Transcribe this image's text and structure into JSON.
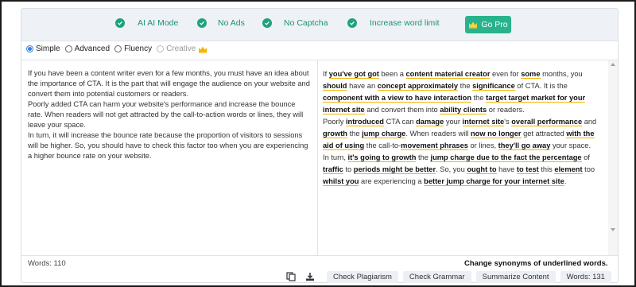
{
  "features": [
    {
      "label": "AI AI Mode",
      "icon": "check-circle-icon"
    },
    {
      "label": "No Ads",
      "icon": "check-circle-icon"
    },
    {
      "label": "No Captcha",
      "icon": "check-circle-icon"
    },
    {
      "label": "Increase word limit",
      "icon": "check-circle-icon"
    }
  ],
  "go_pro": {
    "label": "Go Pro",
    "icon": "crown-icon"
  },
  "modes": [
    {
      "label": "Simple",
      "selected": true
    },
    {
      "label": "Advanced",
      "selected": false
    },
    {
      "label": "Fluency",
      "selected": false
    },
    {
      "label": "Creative",
      "selected": false,
      "disabled": true,
      "icon": "crown-icon"
    }
  ],
  "input_text": {
    "p1": "If you have been a content writer even for a few months, you must have an idea about the importance of CTA. It is the part that will engage the audience on your website and convert them into potential customers or readers.",
    "p2": "Poorly added CTA can harm your website's performance and increase the bounce rate. When readers will not get attracted by the call-to-action words or lines, they will leave your space.",
    "p3": "In turn, it will increase the bounce rate because the proportion of visitors to sessions will be higher. So, you should have to check this factor too when you are experiencing a higher bounce rate on your website."
  },
  "output_text": {
    "s1": "If ",
    "s1b": "you've got got",
    "s2": " been a ",
    "s2b": "content material creator",
    "s3": " even for ",
    "s3b": "some",
    "s4": " months, you ",
    "s4b": "should",
    "s5": " have an ",
    "s5b": "concept approximately",
    "s6": " the ",
    "s6b": "significance",
    "s7": " of CTA. It is the ",
    "s7b": "component with a view to have interaction",
    "s8": " the ",
    "s8b": "target target market for your internet site",
    "s9": " and convert them into ",
    "s9b": "ability clients",
    "s10": " or readers.",
    "s11": "Poorly ",
    "s11b": "introduced",
    "s12": " CTA can ",
    "s12b": "damage",
    "s13": " your ",
    "s13b": "internet site",
    "s14": "'s ",
    "s14b": "overall performance",
    "s15": " and ",
    "s15b": "growth",
    "s16": " the ",
    "s16b": "jump charge",
    "s17": ". When readers will ",
    "s17b": "now no longer",
    "s18": " get attracted ",
    "s18b": "with the aid of using",
    "s19": " the call-to-",
    "s19b": "movement phrases",
    "s20": " or lines, ",
    "s20b": "they'll go away",
    "s21": " your space.",
    "s22": "In turn, ",
    "s22b": "it's going to growth",
    "s23": " the ",
    "s23b": "jump charge due to the fact the percentage",
    "s24": " of ",
    "s24b": "traffic",
    "s25": " to ",
    "s25b": "periods might be better",
    "s26": ". So, you ",
    "s26b": "ought to",
    "s27": " have ",
    "s27b": "to test",
    "s28": " this ",
    "s28b": "element",
    "s29": " too ",
    "s29b": "whilst you",
    "s30": " are experiencing a ",
    "s30b": "better jump charge for your internet site",
    "s31": "."
  },
  "footer": {
    "words_left": "Words: 110",
    "hint": "Change synonyms of underlined words.",
    "copy_icon": "copy-icon",
    "download_icon": "download-icon",
    "check_plagiarism": "Check Plagiarism",
    "check_grammar": "Check Grammar",
    "summarize": "Summarize Content",
    "words_right": "Words: 131"
  },
  "colors": {
    "accent": "#29b38d",
    "check": "#20a37a",
    "underline": "#f0b400",
    "radio": "#2f7fe0"
  }
}
